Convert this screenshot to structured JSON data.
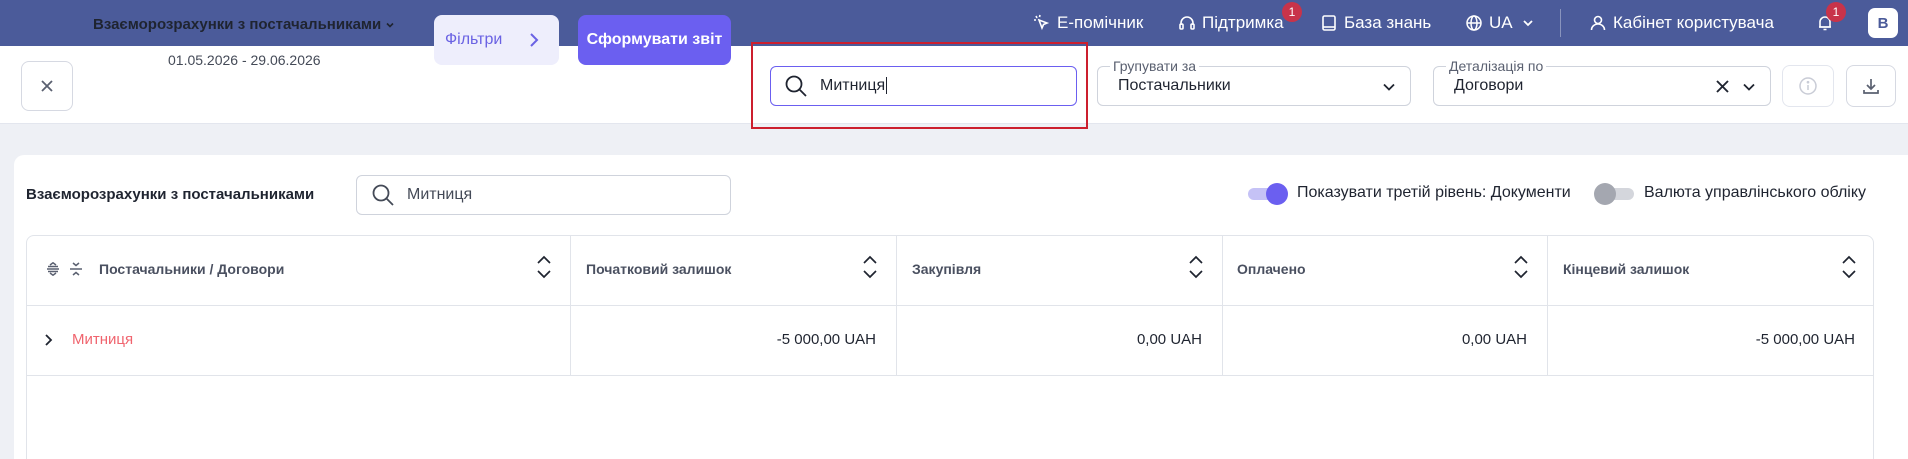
{
  "topbar": {
    "assistant_label": "Е-помічник",
    "support_label": "Підтримка",
    "support_badge": "1",
    "knowledge_label": "База знань",
    "language_label": "UA",
    "cabinet_label": "Кабінет користувача",
    "notifications_badge": "1",
    "avatar_letter": "B"
  },
  "toolbar": {
    "report_title": "Взаєморозрахунки з постачальниками",
    "report_dates": "01.05.2026 - 29.06.2026",
    "filters_label": "Фільтри",
    "generate_label": "Сформувати звіт",
    "search_value": "Митниця",
    "group_by_legend": "Групувати за",
    "group_by_value": "Постачальники",
    "detail_legend": "Деталізація по",
    "detail_value": "Договори"
  },
  "content": {
    "title": "Взаєморозрахунки з постачальниками",
    "search_value": "Митниця",
    "toggle_third_level_label": "Показувати третій рівень: Документи",
    "toggle_third_level_on": true,
    "toggle_currency_label": "Валюта управлінського обліку",
    "toggle_currency_on": false
  },
  "table": {
    "columns": [
      "Постачальники / Договори",
      "Початковий залишок",
      "Закупівля",
      "Оплачено",
      "Кінцевий залишок"
    ],
    "rows": [
      {
        "supplier": "Митниця",
        "opening": "-5 000,00 UAH",
        "purchase": "0,00 UAH",
        "paid": "0,00 UAH",
        "closing": "-5 000,00 UAH"
      }
    ]
  },
  "colors": {
    "topbar": "#4b5b9a",
    "accent": "#6b5ff0",
    "highlight": "#cc1f2e",
    "supplier_link": "#f0646e",
    "badge": "#c8334a"
  }
}
